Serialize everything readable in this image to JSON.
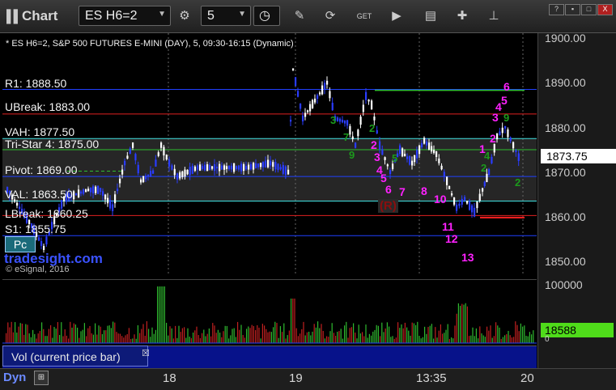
{
  "toolbar": {
    "title": "Chart",
    "symbol": "ES H6=2",
    "interval": "5",
    "icons": [
      "pause-icon",
      "link-icon",
      "clock-icon",
      "pencil-icon",
      "refresh-icon",
      "get-icon",
      "play-icon",
      "tools-icon",
      "pin-icon"
    ]
  },
  "window": {
    "buttons": [
      "?",
      "▪",
      "□",
      "X"
    ]
  },
  "header": "* ES H6=2, S&P 500 FUTURES E-MINI (DAY), 5, 09:30-16:15 (Dynamic)",
  "levels": [
    {
      "label": "R1: 1888.50",
      "price": 1888.5,
      "color": "#2040ff"
    },
    {
      "label": "UBreak: 1883.00",
      "price": 1883.0,
      "color": "#e02020"
    },
    {
      "label": "VAH: 1877.50",
      "price": 1877.5,
      "color": "#40e0e0"
    },
    {
      "label": "Tri-Star 4: 1875.00",
      "price": 1875.0,
      "color": "#2fbf2f"
    },
    {
      "label": "Pivot: 1869.00",
      "price": 1869.0,
      "color": "#2040ff"
    },
    {
      "label": "VAL: 1863.50",
      "price": 1863.5,
      "color": "#40e0e0"
    },
    {
      "label": "LBreak: 1860.25",
      "price": 1860.25,
      "color": "#e02020"
    },
    {
      "label": "S1: 1855.75",
      "price": 1855.75,
      "color": "#2040ff"
    }
  ],
  "price_axis": [
    "1900.00",
    "1890.00",
    "1880.00",
    "1870.00",
    "1860.00",
    "1850.00"
  ],
  "current_price": "1873.75",
  "volume_axis": {
    "top": "100000",
    "current": "18588",
    "bottom": "0"
  },
  "volume_label": "Vol (current price bar)",
  "x_axis": [
    "18",
    "19",
    "13:35",
    "20"
  ],
  "footer": {
    "dyn": "Dyn"
  },
  "badge": "Pc",
  "watermark": "tradesight.com",
  "copyright": "© eSignal, 2016",
  "counts_magenta": [
    "1",
    "2",
    "3",
    "4",
    "5",
    "6",
    "7",
    "8",
    "10",
    "11",
    "12",
    "13",
    "1",
    "2",
    "3",
    "4",
    "5",
    "6"
  ],
  "counts_green": [
    "3",
    "7",
    "9",
    "2",
    "5",
    "9",
    "2",
    "4",
    "2"
  ],
  "r_label": "(R)",
  "colors": {
    "up": "#ffffff",
    "down": "#2a3cff",
    "vol_up": "#2fb82f",
    "vol_down": "#c02020"
  }
}
